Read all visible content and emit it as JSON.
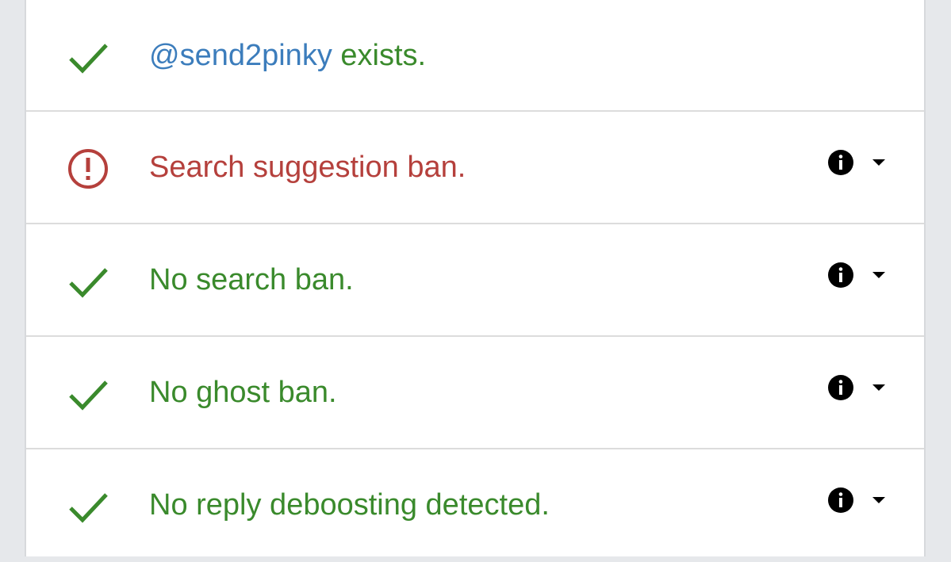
{
  "colors": {
    "success": "#3a8a2c",
    "error": "#b5403c",
    "handle": "#3c7dbc"
  },
  "results": [
    {
      "status": "success",
      "icon": "check-icon",
      "handle": "@send2pinky",
      "text": " exists.",
      "has_details": false
    },
    {
      "status": "error",
      "icon": "exclamation-circle-icon",
      "text": "Search suggestion ban.",
      "has_details": true,
      "details_icons": [
        "info-icon",
        "caret-down-icon"
      ]
    },
    {
      "status": "success",
      "icon": "check-icon",
      "text": "No search ban.",
      "has_details": true,
      "details_icons": [
        "info-icon",
        "caret-down-icon"
      ]
    },
    {
      "status": "success",
      "icon": "check-icon",
      "text": "No ghost ban.",
      "has_details": true,
      "details_icons": [
        "info-icon",
        "caret-down-icon"
      ]
    },
    {
      "status": "success",
      "icon": "check-icon",
      "text": "No reply deboosting detected.",
      "has_details": true,
      "details_icons": [
        "info-icon",
        "caret-down-icon"
      ]
    }
  ]
}
